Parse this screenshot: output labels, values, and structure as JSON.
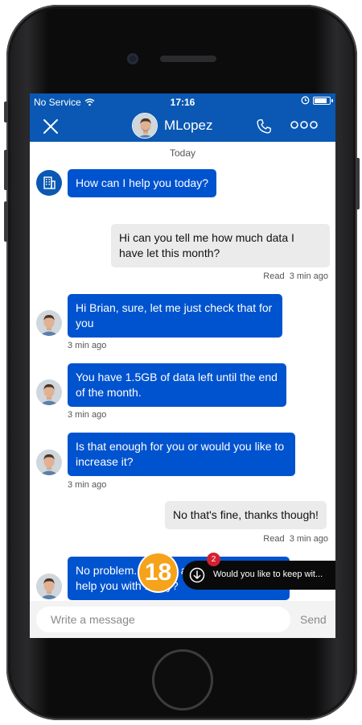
{
  "status_bar": {
    "carrier": "No Service",
    "time": "17:16"
  },
  "header": {
    "contact_name": "MLopez"
  },
  "chat": {
    "day_label": "Today",
    "messages": [
      {
        "sender": "agent",
        "text": "How can I help you today?"
      },
      {
        "sender": "user",
        "text": "Hi can you tell me how much data I have let this month?",
        "status": "Read",
        "time": "3 min ago"
      },
      {
        "sender": "agent",
        "text": "Hi Brian, sure, let me just check that for you",
        "time": "3 min ago"
      },
      {
        "sender": "agent",
        "text": "You have 1.5GB of data left until the end of the month.",
        "time": "3 min ago"
      },
      {
        "sender": "agent",
        "text": "Is that enough for you or would you like to increase it?",
        "time": "3 min ago"
      },
      {
        "sender": "user",
        "text": "No that's fine, thanks though!",
        "status": "Read",
        "time": "3 min ago"
      },
      {
        "sender": "agent",
        "text": "No problem. Is there anything else I can help you with today?"
      }
    ]
  },
  "toast": {
    "text": "Would you like to keep wit...",
    "badge_count": "2"
  },
  "step_badge": "18",
  "composer": {
    "placeholder": "Write a message",
    "send_label": "Send"
  },
  "colors": {
    "brand_blue": "#0a58b3",
    "agent_bubble": "#0053cf",
    "user_bubble": "#ebebeb",
    "badge_orange": "#f5a31a",
    "badge_red": "#d32030"
  },
  "icons": [
    "close-icon",
    "phone-icon",
    "more-icon",
    "building-icon",
    "download-arrow-icon",
    "wifi-icon",
    "alarm-icon",
    "battery-icon"
  ]
}
